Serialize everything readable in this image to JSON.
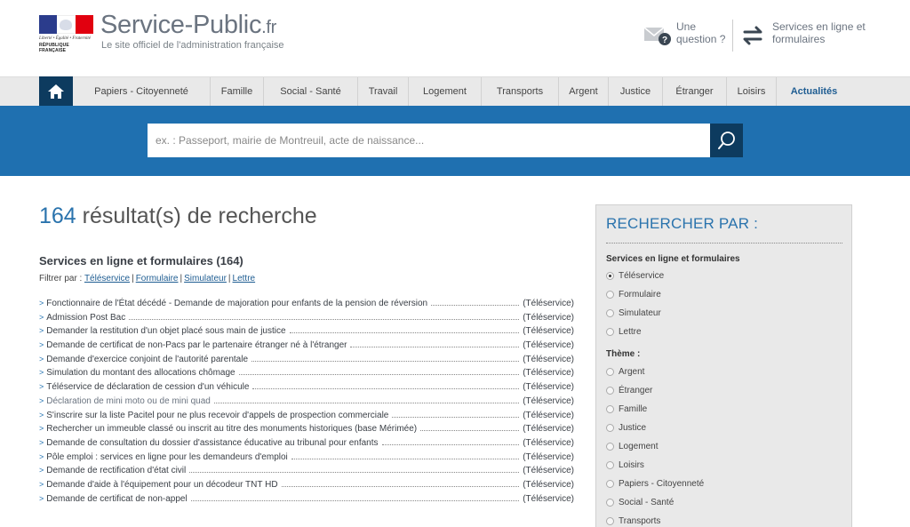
{
  "header": {
    "motto": "Liberté • Égalité • Fraternité",
    "republic": "RÉPUBLIQUE FRANÇAISE",
    "site_name": "Service-Public",
    "site_tld": ".fr",
    "tagline": "Le site officiel de l'administration française",
    "question_label": "Une question ?",
    "services_label": "Services en ligne et formulaires"
  },
  "nav": {
    "items": [
      {
        "label": "Papiers - Citoyenneté"
      },
      {
        "label": "Famille"
      },
      {
        "label": "Social - Santé"
      },
      {
        "label": "Travail"
      },
      {
        "label": "Logement"
      },
      {
        "label": "Transports"
      },
      {
        "label": "Argent"
      },
      {
        "label": "Justice"
      },
      {
        "label": "Étranger"
      },
      {
        "label": "Loisirs"
      },
      {
        "label": "Actualités"
      }
    ]
  },
  "search": {
    "placeholder": "ex. : Passeport, mairie de Montreuil, acte de naissance..."
  },
  "results": {
    "count": "164",
    "title_suffix": "résultat(s) de recherche",
    "section_title": "Services en ligne et formulaires (164)",
    "filter_label": "Filtrer par :",
    "filters": [
      "Téléservice",
      "Formulaire",
      "Simulateur",
      "Lettre"
    ],
    "items": [
      {
        "title": "Fonctionnaire de l'État décédé - Demande de majoration pour enfants de la pension de réversion",
        "kind": "(Téléservice)"
      },
      {
        "title": "Admission Post Bac",
        "kind": "(Téléservice)"
      },
      {
        "title": "Demander la restitution d'un objet placé sous main de justice",
        "kind": "(Téléservice)"
      },
      {
        "title": "Demande de certificat de non-Pacs par le partenaire étranger né à l'étranger",
        "kind": "(Téléservice)"
      },
      {
        "title": "Demande d'exercice conjoint de l'autorité parentale",
        "kind": "(Téléservice)"
      },
      {
        "title": "Simulation du montant des allocations chômage",
        "kind": "(Téléservice)"
      },
      {
        "title": "Téléservice de déclaration de cession d'un véhicule",
        "kind": "(Téléservice)"
      },
      {
        "title": "Déclaration de mini moto ou de mini quad",
        "kind": "(Téléservice)"
      },
      {
        "title": "S'inscrire sur la liste Pacitel pour ne plus recevoir d'appels de prospection commerciale",
        "kind": "(Téléservice)"
      },
      {
        "title": "Rechercher un immeuble classé ou inscrit au titre des monuments historiques (base Mérimée)",
        "kind": "(Téléservice)"
      },
      {
        "title": "Demande de consultation du dossier d'assistance éducative au tribunal pour enfants",
        "kind": "(Téléservice)"
      },
      {
        "title": "Pôle emploi : services en ligne pour les demandeurs d'emploi",
        "kind": "(Téléservice)"
      },
      {
        "title": "Demande de rectification d'état civil",
        "kind": "(Téléservice)"
      },
      {
        "title": "Demande d'aide à l'équipement pour un décodeur TNT HD",
        "kind": "(Téléservice)"
      },
      {
        "title": "Demande de certificat de non-appel",
        "kind": "(Téléservice)"
      }
    ]
  },
  "sidebar": {
    "title": "RECHERCHER PAR :",
    "group_services": "Services en ligne et formulaires",
    "services_options": [
      {
        "label": "Téléservice",
        "checked": true
      },
      {
        "label": "Formulaire",
        "checked": false
      },
      {
        "label": "Simulateur",
        "checked": false
      },
      {
        "label": "Lettre",
        "checked": false
      }
    ],
    "group_theme": "Thème :",
    "theme_options": [
      {
        "label": "Argent"
      },
      {
        "label": "Étranger"
      },
      {
        "label": "Famille"
      },
      {
        "label": "Justice"
      },
      {
        "label": "Logement"
      },
      {
        "label": "Loisirs"
      },
      {
        "label": "Papiers - Citoyenneté"
      },
      {
        "label": "Social - Santé"
      },
      {
        "label": "Transports"
      }
    ]
  },
  "colors": {
    "band": "#1f70b0",
    "dark_blue": "#0d3b5f",
    "link": "#1f5d92"
  }
}
